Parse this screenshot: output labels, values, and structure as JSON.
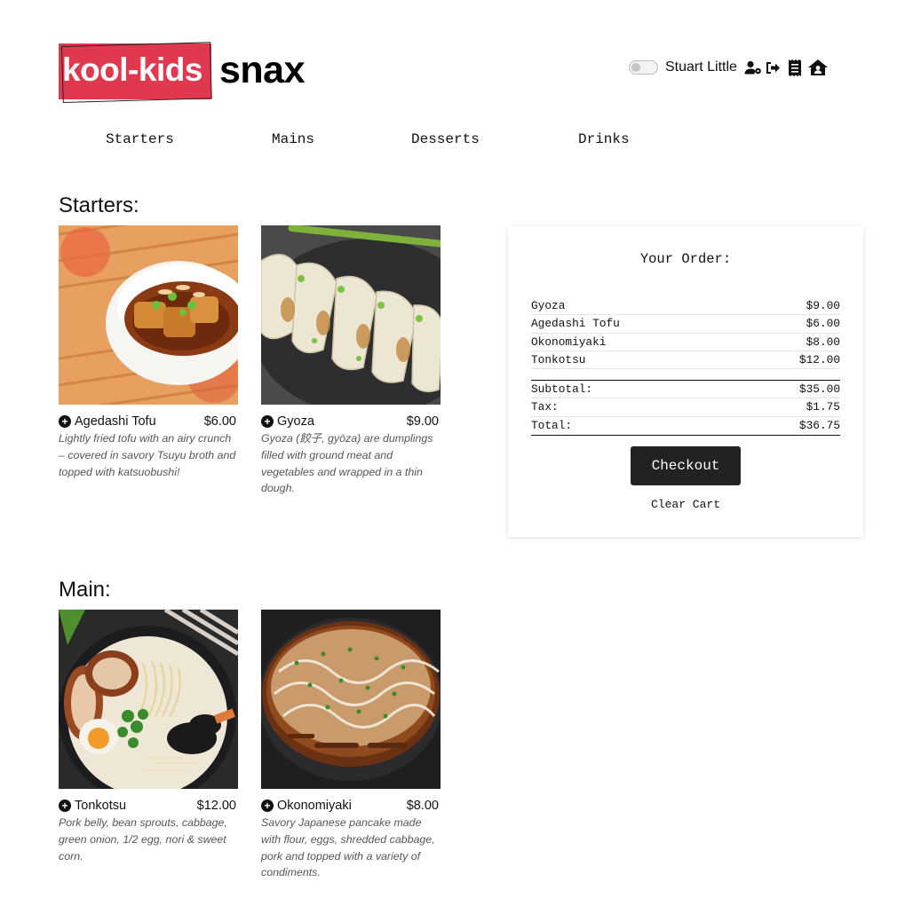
{
  "brand": {
    "part1": "kool-kids",
    "part2": "snax",
    "accent_color": "#e0394f"
  },
  "user": {
    "name": "Stuart Little",
    "icons": [
      "toggle-switch",
      "user-settings-icon",
      "logout-icon",
      "receipt-icon",
      "home-icon"
    ]
  },
  "nav": {
    "starters": "Starters",
    "mains": "Mains",
    "desserts": "Desserts",
    "drinks": "Drinks"
  },
  "sections": {
    "starters": {
      "title": "Starters:",
      "items": [
        {
          "name": "Agedashi Tofu",
          "price": "$6.00",
          "description": "Lightly fried tofu with an airy crunch – covered in savory Tsuyu broth and topped with katsuobushi!"
        },
        {
          "name": "Gyoza",
          "price": "$9.00",
          "description": "Gyoza (餃子, gyōza) are dumplings filled with ground meat and vegetables and wrapped in a thin dough."
        }
      ]
    },
    "mains": {
      "title": "Main:",
      "items": [
        {
          "name": "Tonkotsu",
          "price": "$12.00",
          "description": "Pork belly, bean sprouts, cabbage, green onion, 1/2 egg, nori & sweet corn."
        },
        {
          "name": "Okonomiyaki",
          "price": "$8.00",
          "description": "Savory Japanese pancake made with flour, eggs, shredded cabbage, pork and topped with a variety of condiments."
        }
      ]
    }
  },
  "order": {
    "title": "Your Order:",
    "lines": [
      {
        "name": "Gyoza",
        "price": "$9.00"
      },
      {
        "name": "Agedashi Tofu",
        "price": "$6.00"
      },
      {
        "name": "Okonomiyaki",
        "price": "$8.00"
      },
      {
        "name": "Tonkotsu",
        "price": "$12.00"
      }
    ],
    "subtotal_label": "Subtotal:",
    "subtotal": "$35.00",
    "tax_label": "Tax:",
    "tax": "$1.75",
    "total_label": "Total:",
    "total": "$36.75",
    "checkout_label": "Checkout",
    "clear_label": "Clear Cart"
  }
}
